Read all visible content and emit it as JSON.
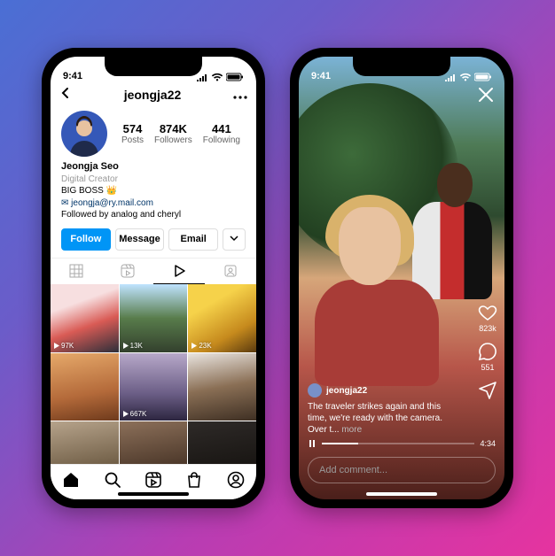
{
  "status": {
    "time": "9:41"
  },
  "left": {
    "username": "jeongja22",
    "avatar_color": "#3558b8",
    "stats": {
      "posts": {
        "value": "574",
        "label": "Posts"
      },
      "followers": {
        "value": "874K",
        "label": "Followers"
      },
      "following": {
        "value": "441",
        "label": "Following"
      }
    },
    "bio": {
      "name": "Jeongja Seo",
      "category": "Digital Creator",
      "line1": "BIG BOSS 👑",
      "email": "✉ jeongja@ry.mail.com",
      "followed_by": "Followed by analog and cheryl"
    },
    "buttons": {
      "follow": "Follow",
      "message": "Message",
      "email": "Email"
    },
    "tabs": [
      "grid",
      "reels",
      "video",
      "tagged"
    ],
    "active_tab": 2,
    "grid": [
      {
        "views": "97K"
      },
      {
        "views": "13K"
      },
      {
        "views": "23K"
      },
      {
        "views": ""
      },
      {
        "views": "667K"
      },
      {
        "views": ""
      },
      {
        "views": ""
      },
      {
        "views": ""
      },
      {
        "views": ""
      }
    ]
  },
  "right": {
    "username": "jeongja22",
    "caption": "The traveler strikes again and this time, we're ready with the camera. Over t...",
    "more": "more",
    "likes": "823k",
    "comments": "551",
    "duration": "4:34",
    "comment_placeholder": "Add comment..."
  }
}
